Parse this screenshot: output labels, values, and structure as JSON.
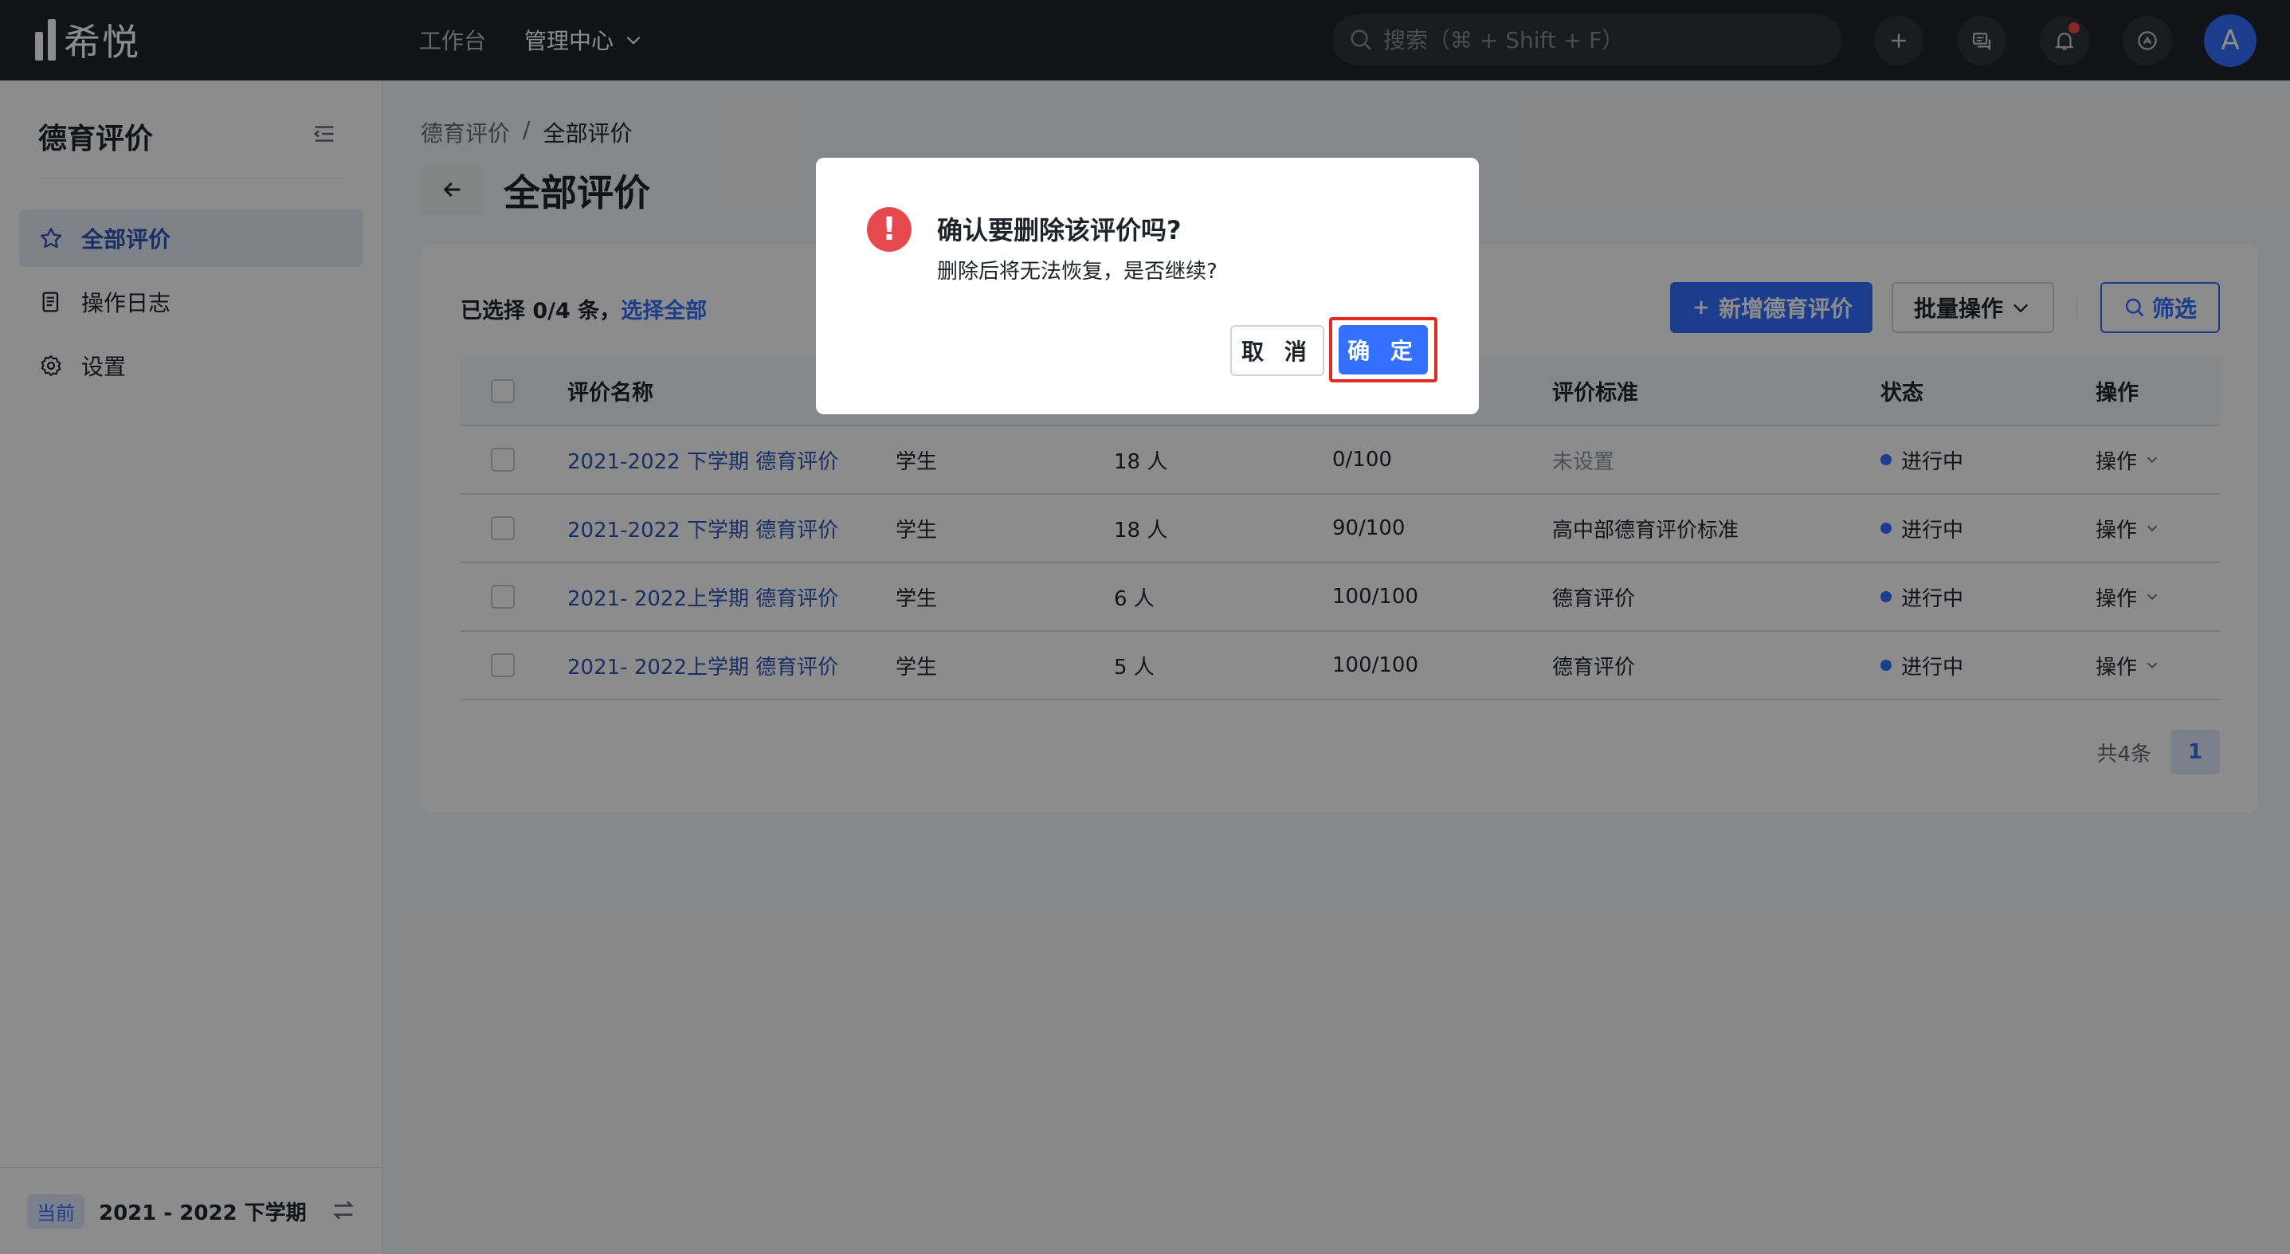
{
  "app": {
    "name": "希悦",
    "nav": [
      {
        "label": "工作台",
        "active": false
      },
      {
        "label": "管理中心",
        "active": true
      }
    ],
    "search_placeholder": "搜索（⌘ + Shift + F）",
    "avatar_letter": "A"
  },
  "sidebar": {
    "title": "德育评价",
    "items": [
      {
        "label": "全部评价",
        "icon": "star-icon",
        "active": true
      },
      {
        "label": "操作日志",
        "icon": "document-icon",
        "active": false
      },
      {
        "label": "设置",
        "icon": "gear-icon",
        "active": false
      }
    ],
    "term_tag": "当前",
    "term": "2021 - 2022 下学期"
  },
  "main": {
    "breadcrumb": [
      "德育评价",
      "全部评价"
    ],
    "breadcrumb_sep": "/",
    "title": "全部评价",
    "selection_prefix": "已选择 0/4 条，",
    "select_all": "选择全部",
    "add_button": "新增德育评价",
    "batch_button": "批量操作",
    "filter_button": "筛选",
    "table": {
      "headers": [
        "评价名称",
        "",
        "",
        "",
        "评价标准",
        "状态",
        "操作"
      ],
      "rows": [
        {
          "name": "2021-2022 下学期 德育评价",
          "target": "学生",
          "people": "18 人",
          "progress": "0/100",
          "standard": "未设置",
          "standard_muted": true,
          "status": "进行中",
          "action": "操作"
        },
        {
          "name": "2021-2022 下学期 德育评价",
          "target": "学生",
          "people": "18 人",
          "progress": "90/100",
          "standard": "高中部德育评价标准",
          "standard_muted": false,
          "status": "进行中",
          "action": "操作"
        },
        {
          "name": "2021- 2022上学期 德育评价",
          "target": "学生",
          "people": "6 人",
          "progress": "100/100",
          "standard": "德育评价",
          "standard_muted": false,
          "status": "进行中",
          "action": "操作"
        },
        {
          "name": "2021- 2022上学期 德育评价",
          "target": "学生",
          "people": "5 人",
          "progress": "100/100",
          "standard": "德育评价",
          "standard_muted": false,
          "status": "进行中",
          "action": "操作"
        }
      ]
    },
    "pagination": {
      "total": "共4条",
      "current": "1"
    }
  },
  "dialog": {
    "title": "确认要删除该评价吗?",
    "description": "删除后将无法恢复，是否继续?",
    "cancel": "取 消",
    "confirm": "确 定"
  },
  "colors": {
    "primary": "#3370ff",
    "topbar": "#1f2329",
    "danger": "#e5484d",
    "highlight_border": "#e02b20"
  }
}
